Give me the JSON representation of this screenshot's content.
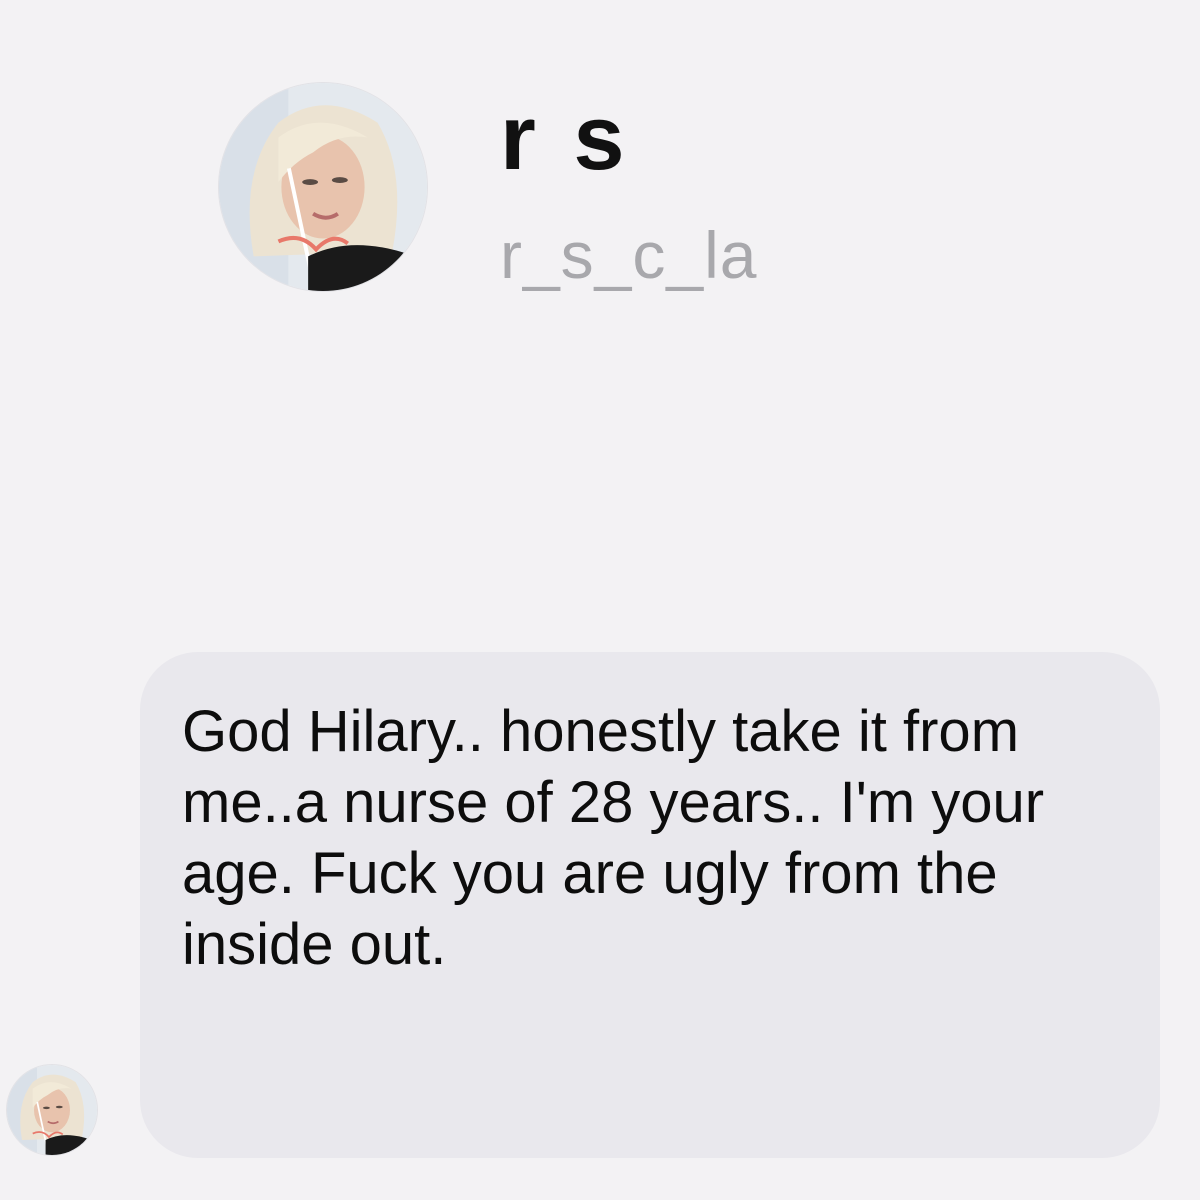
{
  "profile": {
    "display_name": "r s",
    "username": "r_s_c_la",
    "avatar_icon": "profile-photo-avatar"
  },
  "message": {
    "text": "God Hilary.. honestly take it from me..a nurse of 28 years.. I'm your age. Fuck you are ugly from the inside out.",
    "sender_avatar_icon": "profile-photo-avatar"
  },
  "colors": {
    "background": "#f3f2f4",
    "bubble": "#e9e8ed",
    "username": "#a8a8ac"
  }
}
